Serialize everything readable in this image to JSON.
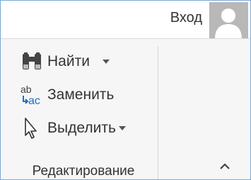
{
  "header": {
    "login_label": "Вход"
  },
  "editing_group": {
    "find_label": "Найти",
    "replace_label": "Заменить",
    "select_label": "Выделить",
    "group_label": "Редактирование"
  },
  "icons": {
    "find": "binoculars-icon",
    "replace": "replace-ab-ac-icon",
    "select": "arrow-pointer-icon",
    "collapse": "chevron-up-icon",
    "avatar": "user-silhouette-icon"
  },
  "colors": {
    "replace_icon_accent": "#1f6fc0",
    "frame_border": "#7aa6d6"
  }
}
